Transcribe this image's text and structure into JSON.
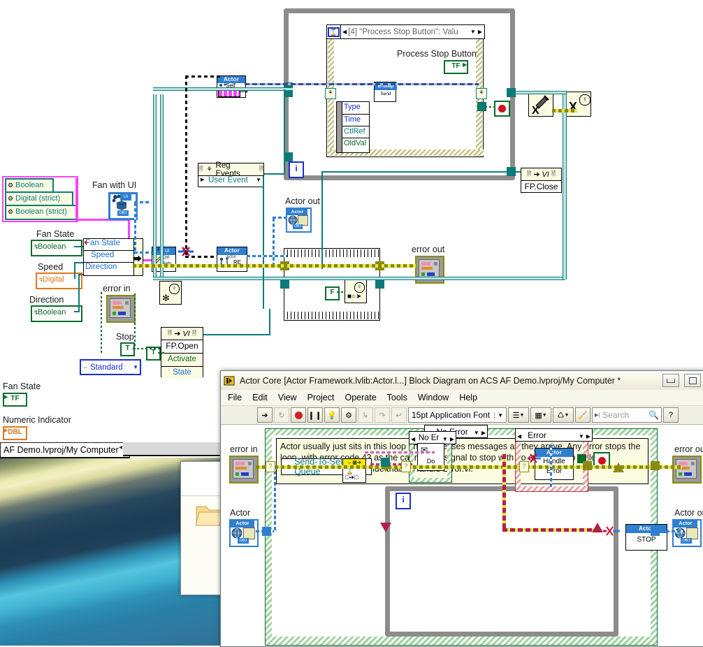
{
  "desktop": {
    "taskbar_button": "AF Demo.lvproj/My Computer",
    "taskbar_caret": "◂"
  },
  "back_diagram": {
    "type_cluster": {
      "items": [
        "Boolean",
        "Digital (strict)",
        "Boolean (strict)"
      ]
    },
    "labels": {
      "fan_with_ui": "Fan with UI",
      "fan_state": "Fan State",
      "speed": "Speed",
      "direction": "Direction",
      "error_in": "error in",
      "stop": "Stop",
      "actor_out": "Actor out",
      "error_out": "error out",
      "process_stop_button": "Process Stop Button",
      "fan_state_indicator": "Fan State",
      "numeric_indicator": "Numeric Indicator"
    },
    "terminals": {
      "fan_state_type": "Boolean",
      "speed_type": "Digital",
      "direction_type": "Boolean",
      "stop_value": "T",
      "activate_value": "T",
      "false_const": "F",
      "fan_state_ind_value": "TF",
      "numeric_ind_value": "DBL",
      "process_stop_value": "TF"
    },
    "bundle": {
      "items": [
        "Fan State",
        "Speed",
        "Direction"
      ]
    },
    "nodes": {
      "ui_ctrl_refs": {
        "header": "UI",
        "line1": "Ctrl",
        "line2": "Refs"
      },
      "actor_set": {
        "header": "Actor",
        "line1": "Actor",
        "line2": "RE"
      },
      "actor_self": {
        "header": "Actor",
        "line1": "Self"
      },
      "fp_open": {
        "icon_text": "VI",
        "body": "FP.Open",
        "terminals": [
          "Activate",
          "State"
        ]
      },
      "fp_close": {
        "icon_text": "VI",
        "body": "FP.Close"
      },
      "reg_events": {
        "title": "Reg Events",
        "row": "User Event"
      },
      "estop": {
        "header": "E-Stop",
        "body": "Send"
      },
      "standard_enum": "Standard"
    },
    "event_structure": {
      "case_label": "[4] \"Process Stop Button\": Valu",
      "node_terminals": [
        "Type",
        "Time",
        "CtlRef",
        "OldVal"
      ],
      "loop_index": "i"
    }
  },
  "window": {
    "title": "Actor Core [Actor Framework.lvlib:Actor.l...] Block Diagram on ACS AF Demo.lvproj/My Computer *",
    "app_icon": "labview-icon",
    "window_buttons": [
      "minimize",
      "restore"
    ],
    "menu": [
      "File",
      "Edit",
      "View",
      "Project",
      "Operate",
      "Tools",
      "Window",
      "Help"
    ],
    "toolbar": {
      "buttons": [
        "run-icon",
        "run-continuously-icon",
        "abort-icon",
        "pause-icon",
        "highlight-execution-icon",
        "retain-wire-values-icon",
        "step-into-icon",
        "step-over-icon",
        "step-out-icon"
      ],
      "font_selector": "15pt Application Font",
      "align_objects": "align-objects-icon",
      "distribute_objects": "distribute-objects-icon",
      "reorder": "reorder-icon",
      "cleanup_diagram": "cleanup-diagram-icon",
      "search_placeholder": "Search",
      "search_value": "",
      "search_icon": "magnifier-icon",
      "help_icon": "context-help-icon"
    },
    "diagram": {
      "outer_case_label": "No Error",
      "comment": "Actor usually just sits in this loop and processes messages as they arrive. Any error stops the loop, with error code 43 as the cannonical signal to stop with no error sent to caller. Descendants  may override that in Handle Error.vi.",
      "loop_index": "i",
      "labels": {
        "error_in": "error in",
        "actor_in": "Actor",
        "error_out": "error out",
        "actor_out": "Actor ou"
      },
      "send_to_self_queue": "Send-To-Self Queue",
      "inner_case_label": "No Er",
      "error_case_label": "Error",
      "do_node": "Do",
      "handle_error_node": {
        "header": "Actor",
        "line1": "Handle",
        "line2": "Error"
      },
      "stop_node": {
        "header": "Actor",
        "body": "STOP"
      }
    }
  }
}
